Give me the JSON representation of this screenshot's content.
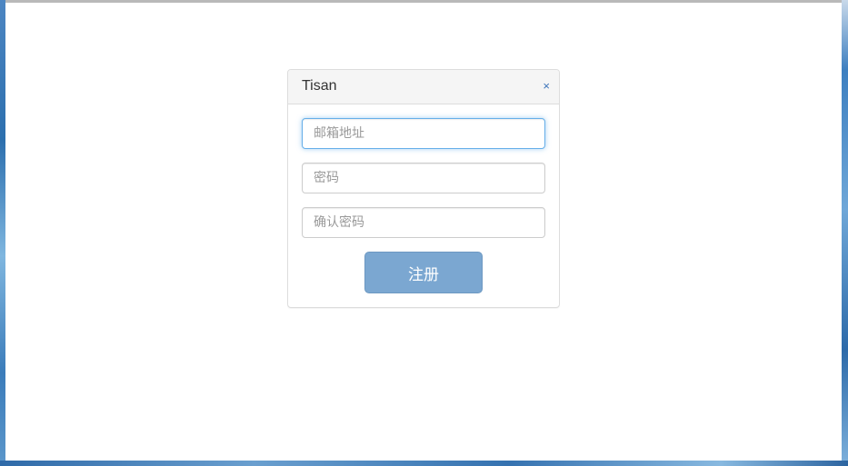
{
  "panel": {
    "title": "Tisan",
    "close_label": "×"
  },
  "form": {
    "email_placeholder": "邮箱地址",
    "password_placeholder": "密码",
    "confirm_password_placeholder": "确认密码",
    "submit_label": "注册"
  }
}
